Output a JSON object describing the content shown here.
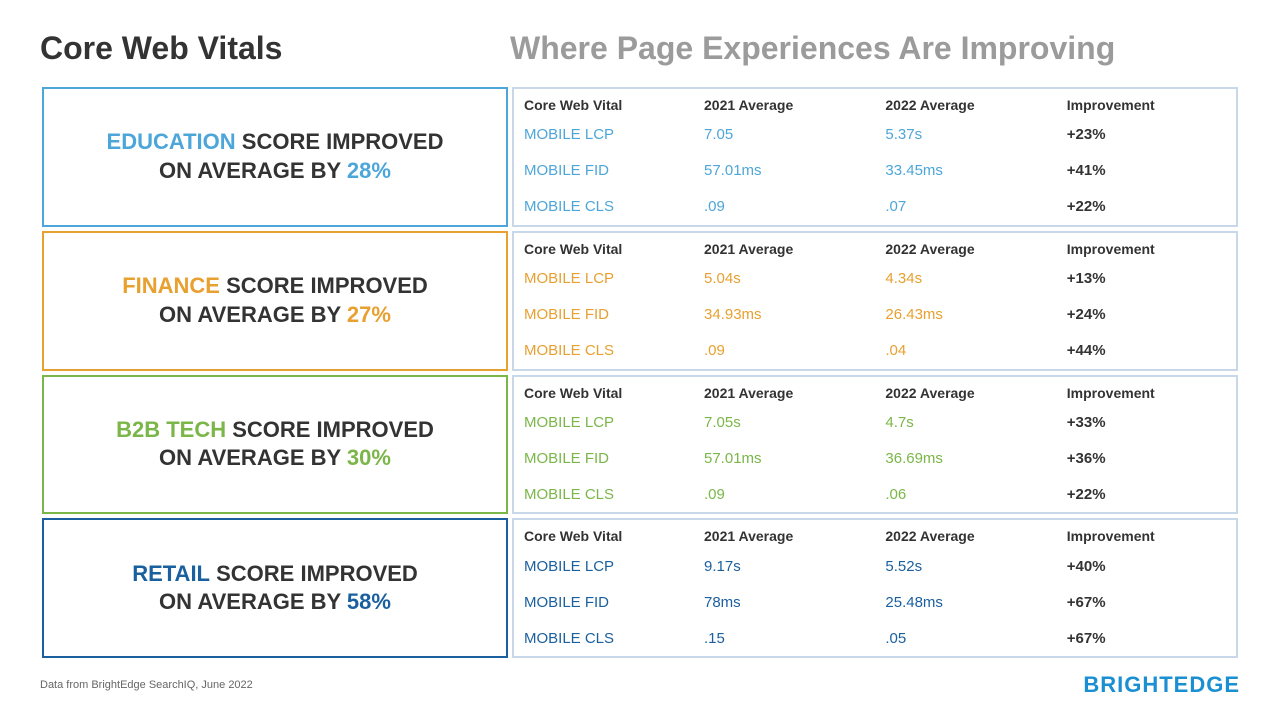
{
  "page": {
    "left_title": "Core Web Vitals",
    "right_title": "Where Page Experiences Are Improving",
    "footer_note": "Data from BrightEdge SearchIQ, June 2022",
    "brightedge": "BRIGHTEDGE"
  },
  "sections": [
    {
      "id": "education",
      "color_class": "blue",
      "industry": "EDUCATION",
      "label": " SCORE IMPROVED\nON AVERAGE BY ",
      "pct": "28%",
      "border_color": "#4da6d9",
      "table_class": "blue-table",
      "columns": [
        "Core Web Vital",
        "2021 Average",
        "2022 Average",
        "Improvement"
      ],
      "rows": [
        [
          "MOBILE LCP",
          "7.05",
          "5.37s",
          "+23%"
        ],
        [
          "MOBILE FID",
          "57.01ms",
          "33.45ms",
          "+41%"
        ],
        [
          "MOBILE CLS",
          ".09",
          ".07",
          "+22%"
        ]
      ]
    },
    {
      "id": "finance",
      "color_class": "orange",
      "industry": "FINANCE",
      "label": " SCORE IMPROVED\nON AVERAGE BY ",
      "pct": "27%",
      "border_color": "#e8a030",
      "table_class": "orange-table",
      "columns": [
        "Core Web Vital",
        "2021 Average",
        "2022 Average",
        "Improvement"
      ],
      "rows": [
        [
          "MOBILE LCP",
          "5.04s",
          "4.34s",
          "+13%"
        ],
        [
          "MOBILE FID",
          "34.93ms",
          "26.43ms",
          "+24%"
        ],
        [
          "MOBILE CLS",
          ".09",
          ".04",
          "+44%"
        ]
      ]
    },
    {
      "id": "b2btech",
      "color_class": "green",
      "industry": "B2B TECH",
      "label": " SCORE IMPROVED\nON AVERAGE BY ",
      "pct": "30%",
      "border_color": "#7ab648",
      "table_class": "green-table",
      "columns": [
        "Core Web Vital",
        "2021 Average",
        "2022 Average",
        "Improvement"
      ],
      "rows": [
        [
          "MOBILE LCP",
          "7.05s",
          "4.7s",
          "+33%"
        ],
        [
          "MOBILE FID",
          "57.01ms",
          "36.69ms",
          "+36%"
        ],
        [
          "MOBILE CLS",
          ".09",
          ".06",
          "+22%"
        ]
      ]
    },
    {
      "id": "retail",
      "color_class": "navy",
      "industry": "RETAIL",
      "label": " SCORE IMPROVED\nON AVERAGE BY ",
      "pct": "58%",
      "border_color": "#1a5f9e",
      "table_class": "navy-table",
      "columns": [
        "Core Web Vital",
        "2021 Average",
        "2022 Average",
        "Improvement"
      ],
      "rows": [
        [
          "MOBILE LCP",
          "9.17s",
          "5.52s",
          "+40%"
        ],
        [
          "MOBILE FID",
          "78ms",
          "25.48ms",
          "+67%"
        ],
        [
          "MOBILE CLS",
          ".15",
          ".05",
          "+67%"
        ]
      ]
    }
  ]
}
